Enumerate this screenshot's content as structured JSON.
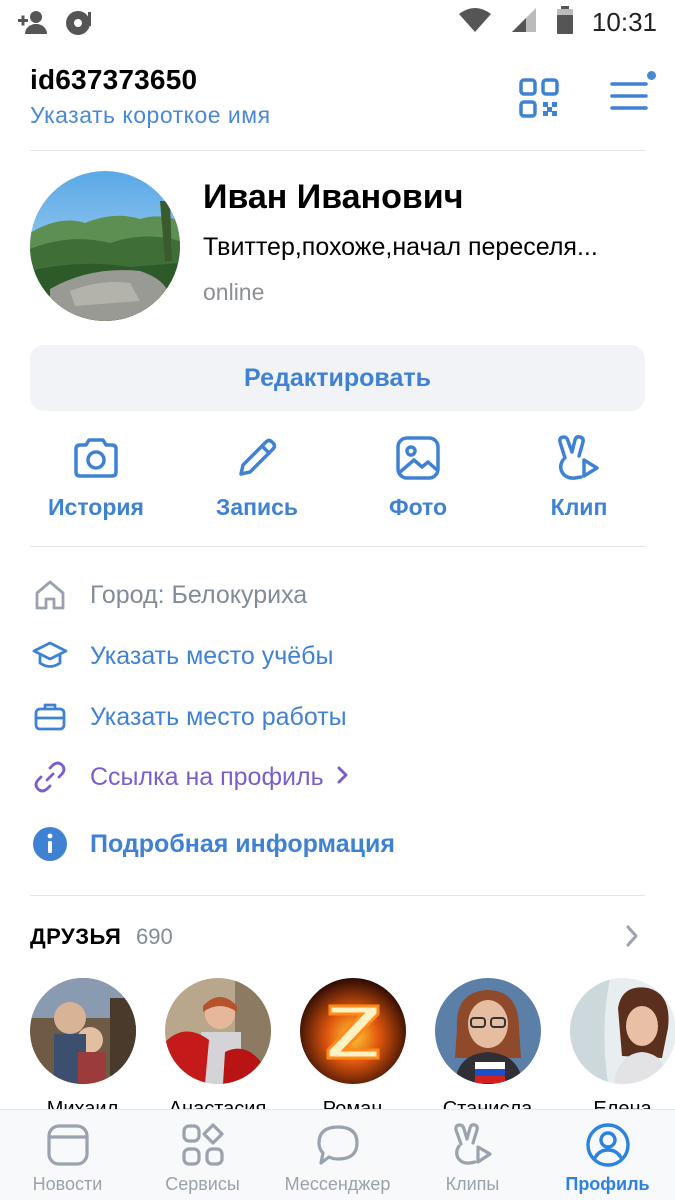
{
  "status_bar": {
    "time": "10:31",
    "icons": [
      "add-friend-icon",
      "media-icon",
      "wifi-icon",
      "signal-icon",
      "battery-icon"
    ]
  },
  "header": {
    "user_id": "id637373650",
    "short_name_link": "Указать короткое имя",
    "icons": [
      "qr-code-icon",
      "menu-icon"
    ]
  },
  "profile": {
    "name": "Иван Иванович",
    "status": "Твиттер,похоже,начал переселя...",
    "online": "online",
    "edit_button": "Редактировать"
  },
  "actions": [
    {
      "label": "История",
      "icon": "camera-icon"
    },
    {
      "label": "Запись",
      "icon": "pencil-icon"
    },
    {
      "label": "Фото",
      "icon": "photo-icon"
    },
    {
      "label": "Клип",
      "icon": "clip-icon"
    }
  ],
  "info": {
    "city": "Город: Белокуриха",
    "education": "Указать место учёбы",
    "work": "Указать место работы",
    "profile_link": "Ссылка на профиль",
    "details": "Подробная информация"
  },
  "friends": {
    "title": "ДРУЗЬЯ",
    "count": "690",
    "list": [
      {
        "name": "Михаил"
      },
      {
        "name": "Анастасия"
      },
      {
        "name": "Роман"
      },
      {
        "name": "Станисла"
      },
      {
        "name": "Елена"
      }
    ]
  },
  "tabbar": {
    "tabs": [
      {
        "label": "Новости",
        "icon": "news-icon"
      },
      {
        "label": "Сервисы",
        "icon": "services-icon"
      },
      {
        "label": "Мессенджер",
        "icon": "messenger-icon"
      },
      {
        "label": "Клипы",
        "icon": "clips-icon"
      },
      {
        "label": "Профиль",
        "icon": "profile-icon"
      }
    ],
    "active": "Профиль"
  },
  "colors": {
    "accent": "#3f82d3",
    "link_purple": "#7b5ecb",
    "secondary_text": "#818c99",
    "button_bg": "#f1f3f6"
  }
}
